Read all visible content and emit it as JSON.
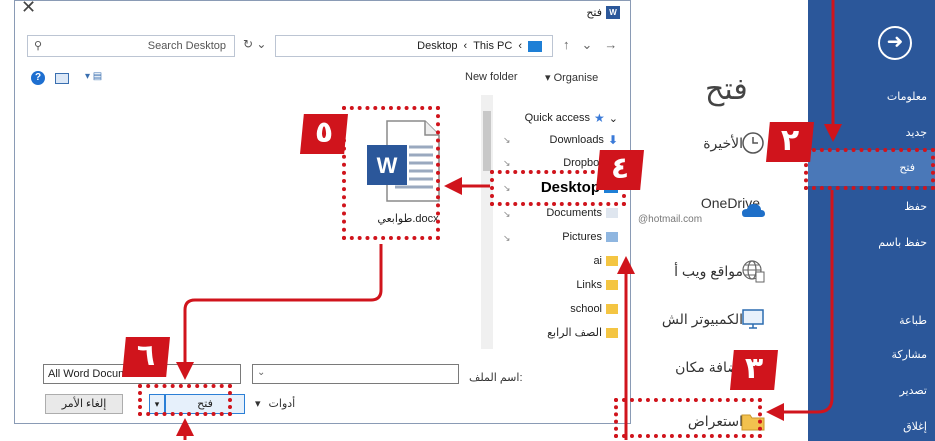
{
  "dialog": {
    "title": "فتح",
    "search_placeholder": "Search Desktop",
    "breadcrumb": [
      "Desktop",
      "This PC"
    ],
    "toolbar": {
      "new_folder": "New folder",
      "organise": "Organise"
    },
    "tree": [
      {
        "label": "Quick access",
        "kind": "star"
      },
      {
        "label": "Downloads",
        "kind": "download"
      },
      {
        "label": "Dropbox",
        "kind": "dropbox"
      },
      {
        "label": "Desktop",
        "kind": "desktop",
        "selected": true
      },
      {
        "label": "Documents",
        "kind": "doc"
      },
      {
        "label": "Pictures",
        "kind": "pic"
      },
      {
        "label": "ai",
        "kind": "folder"
      },
      {
        "label": "Links",
        "kind": "folder"
      },
      {
        "label": "school",
        "kind": "folder"
      },
      {
        "label": "الصف الرابع",
        "kind": "folder"
      }
    ],
    "file": {
      "name": "طوابعي.docx",
      "icon": "word-doc-icon"
    },
    "filename_label": "اسم الملف:",
    "filetype": "All Word Documents",
    "tools_label": "أدوات",
    "open_button": "فتح",
    "cancel_button": "إلغاء الأمر"
  },
  "backstage": {
    "title": "فتح",
    "sidebar": [
      "معلومات",
      "جديد",
      "فتح",
      "حفظ",
      "حفظ باسم",
      "طباعة",
      "مشاركة",
      "تصدير",
      "إغلاق"
    ],
    "selected": "فتح",
    "places": [
      {
        "label": "الأخيرة",
        "icon": "clock-icon"
      },
      {
        "label": "OneDrive",
        "sub": "@hotmail.com",
        "icon": "cloud-icon"
      },
      {
        "label": "مواقع ويب أ",
        "icon": "globe-icon"
      },
      {
        "label": "الكمبيوتر الش",
        "icon": "computer-icon"
      },
      {
        "label": "إضافة مكان",
        "icon": "add-place-icon"
      },
      {
        "label": "استعراض",
        "icon": "folder-icon"
      }
    ]
  },
  "annotations": [
    "٢",
    "٣",
    "٤",
    "٥",
    "٦"
  ],
  "colors": {
    "accent_red": "#d0141c",
    "word_blue": "#2b579a"
  }
}
